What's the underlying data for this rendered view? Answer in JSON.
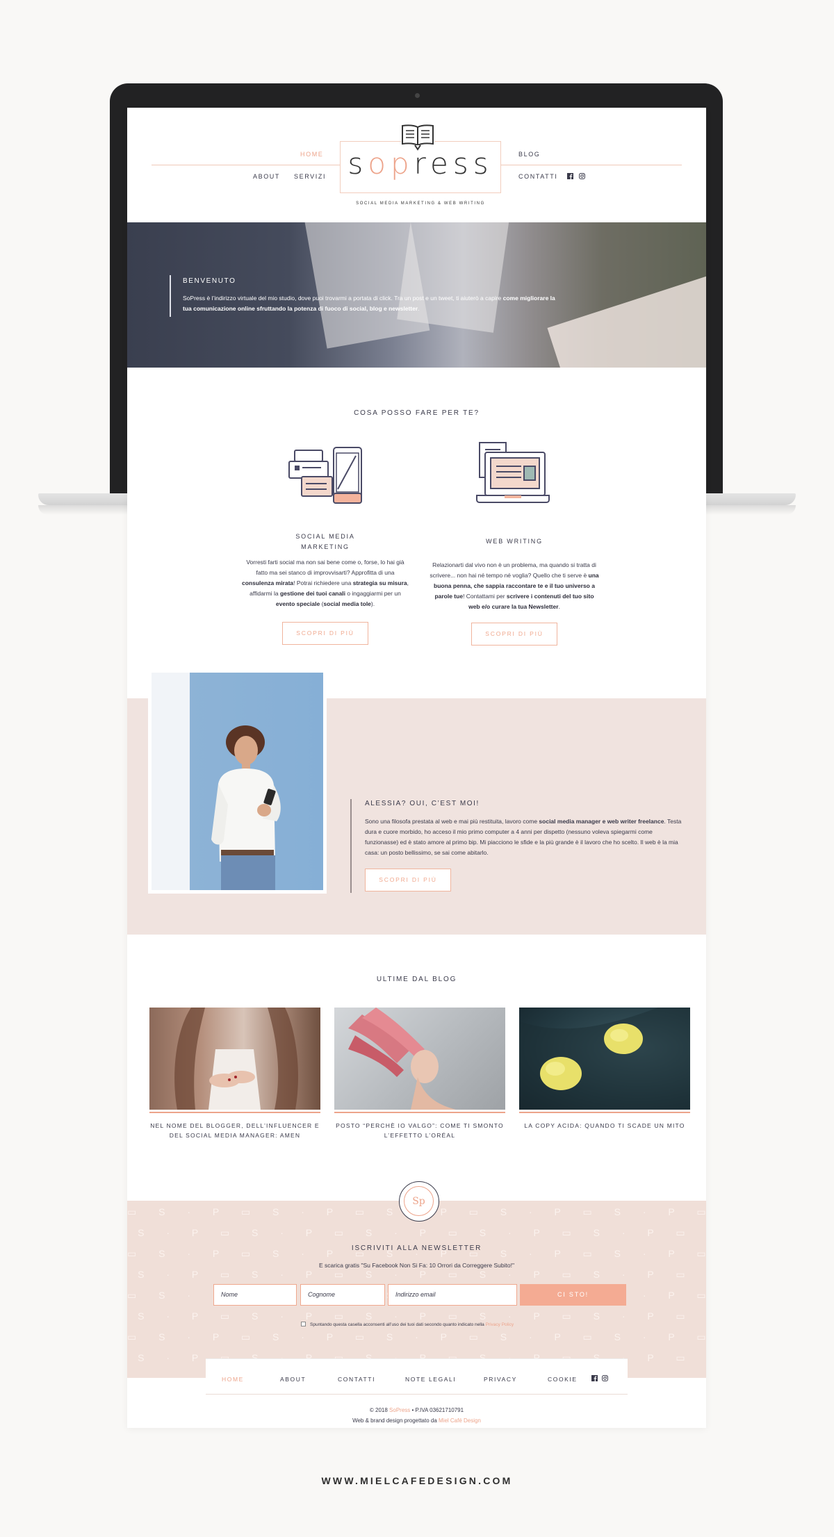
{
  "header": {
    "nav_left_top": "HOME",
    "nav_left_1": "ABOUT",
    "nav_left_2": "SERVIZI",
    "nav_right_top": "BLOG",
    "nav_right_1": "CONTATTI",
    "logo": "sopress",
    "tagline": "SOCIAL MEDIA MARKETING & WEB WRITING",
    "icons": [
      "facebook-icon",
      "instagram-icon"
    ]
  },
  "hero": {
    "title": "BENVENUTO",
    "text_1": "SoPress è l’indirizzo virtuale del mio studio, dove puoi trovarmi a portata di click. Tra un post e un tweet, ti aiuterò a capire ",
    "text_bold": "come migliorare la tua comunicazione online sfruttando la potenza di fuoco di social, blog e newsletter",
    "text_2": "."
  },
  "services": {
    "title": "COSA POSSO FARE PER TE?",
    "items": [
      {
        "title_1": "SOCIAL MEDIA",
        "title_2": "MARKETING",
        "button": "SCOPRI DI PIÙ"
      },
      {
        "title_1": "WEB WRITING",
        "button": "SCOPRI DI PIÙ"
      }
    ]
  },
  "about": {
    "title": "ALESSIA? OUI, C’EST MOI!",
    "button": "SCOPRI DI PIÙ"
  },
  "blog": {
    "title": "ULTIME DAL BLOG",
    "posts": [
      {
        "caption": "NEL NOME DEL BLOGGER, DELL’INFLUENCER E DEL SOCIAL MEDIA MANAGER: AMEN"
      },
      {
        "caption": "POSTO “PERCHÈ IO VALGO”: COME TI SMONTO L’EFFETTO L’ORÉAL"
      },
      {
        "caption": "LA COPY ACIDA: QUANDO TI SCADE UN MITO"
      }
    ]
  },
  "newsletter": {
    "seal": "Sp",
    "title": "ISCRIVITI ALLA NEWSLETTER",
    "subtitle": "E scarica gratis \"Su Facebook Non Si Fa: 10 Orrori da Correggere Subito!\"",
    "name_placeholder": "Nome",
    "surname_placeholder": "Cognome",
    "email_placeholder": "Indirizzo email",
    "button": "CI STO!",
    "consent": "Spuntando questa casella acconsenti all’uso dei tuoi dati secondo quanto indicato nella ",
    "consent_link": "Privacy Policy"
  },
  "footer": {
    "nav": [
      "HOME",
      "ABOUT",
      "CONTATTI",
      "NOTE LEGALI",
      "PRIVACY",
      "COOKIE"
    ],
    "copy_1": "© 2018 ",
    "copy_brand": "SoPress",
    "copy_2": " • P.IVA 03621710791",
    "design_1": "Web & brand design progettato da ",
    "design_link": "Miel Café Design"
  },
  "site_url": "WWW.MIELCAFEDESIGN.COM",
  "colors": {
    "accent": "#eda48b",
    "band": "#f0e3df",
    "dark": "#3a3a4a"
  }
}
